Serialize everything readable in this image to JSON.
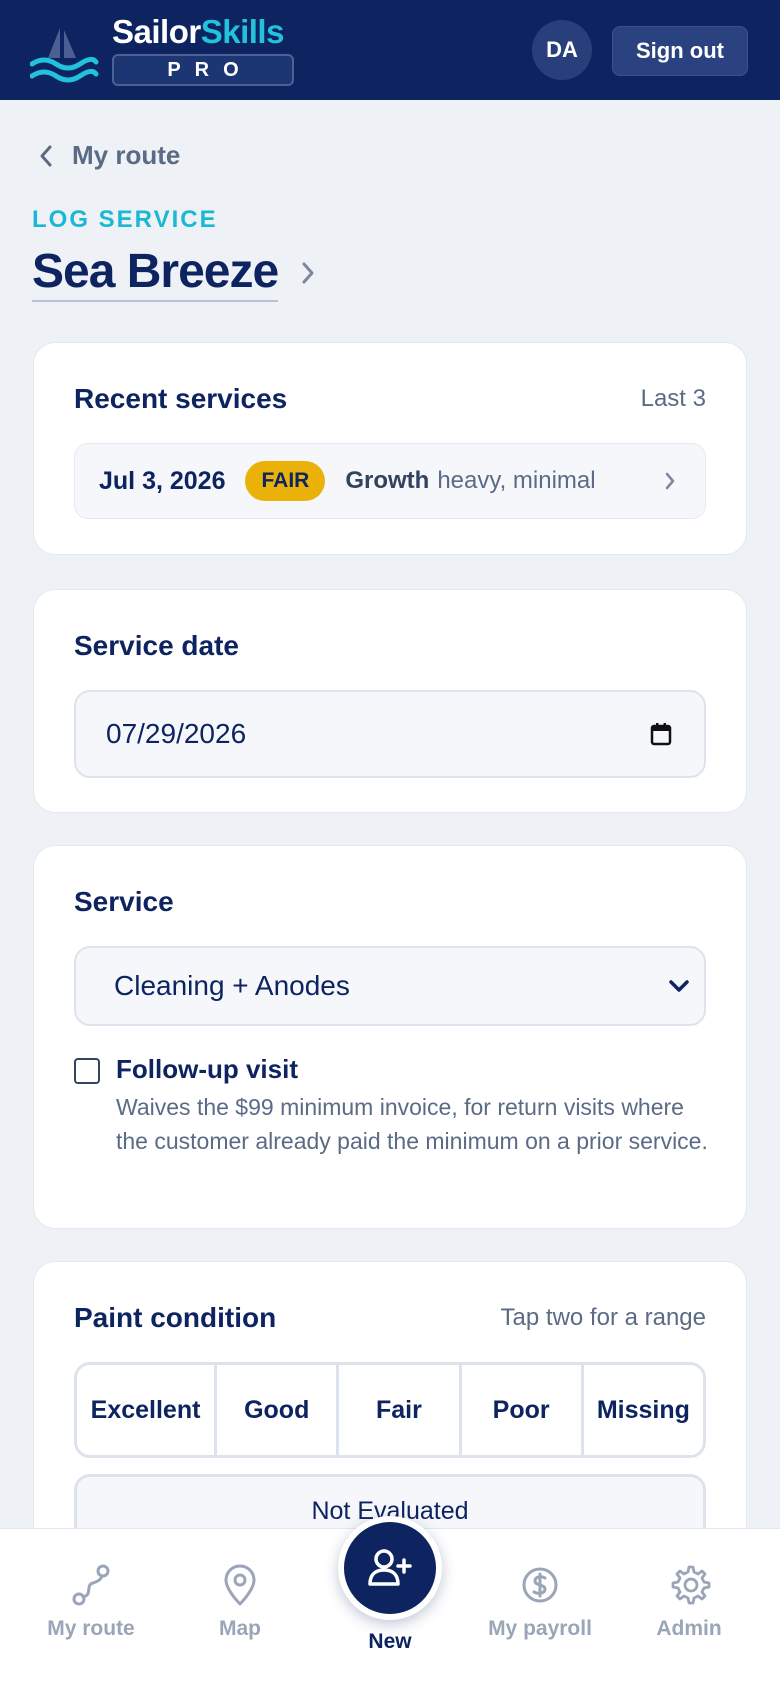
{
  "brand": {
    "name_part1": "Sailor",
    "name_part2": "Skills",
    "badge": "PRO"
  },
  "header": {
    "avatar_initials": "DA",
    "signout_label": "Sign out"
  },
  "nav_back": {
    "label": "My route"
  },
  "page": {
    "kicker": "LOG SERVICE",
    "boat_name": "Sea Breeze"
  },
  "recent_services": {
    "title": "Recent services",
    "hint": "Last 3",
    "items": [
      {
        "date": "Jul 3, 2026",
        "condition": "FAIR",
        "growth_label": "Growth",
        "growth_value": "heavy, minimal"
      }
    ]
  },
  "service_date": {
    "title": "Service date",
    "value": "07/29/2026"
  },
  "service": {
    "title": "Service",
    "selected": "Cleaning + Anodes",
    "followup_label": "Follow-up visit",
    "followup_checked": false,
    "followup_description": "Waives the $99 minimum invoice, for return visits where the customer already paid the minimum on a prior service."
  },
  "paint_condition": {
    "title": "Paint condition",
    "hint": "Tap two for a range",
    "options": [
      "Excellent",
      "Good",
      "Fair",
      "Poor",
      "Missing"
    ],
    "not_evaluated": "Not Evaluated"
  },
  "bottom_nav": {
    "items": [
      "My route",
      "Map",
      "New",
      "My payroll",
      "Admin"
    ],
    "active": "New"
  },
  "colors": {
    "navy": "#0d2461",
    "cyan": "#22c1dc",
    "fair": "#eab208",
    "background": "#eef2f7"
  }
}
